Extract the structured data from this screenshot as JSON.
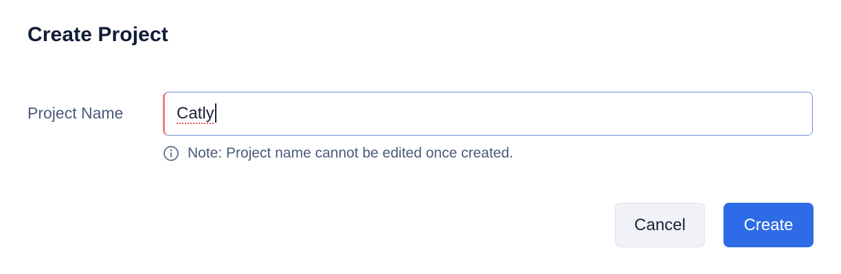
{
  "dialog": {
    "title": "Create Project"
  },
  "form": {
    "project_name": {
      "label": "Project Name",
      "value": "Catly"
    },
    "note": {
      "icon": "info-icon",
      "text": "Note: Project name cannot be edited once created."
    }
  },
  "actions": {
    "cancel_label": "Cancel",
    "create_label": "Create"
  },
  "colors": {
    "primary": "#2e6be6",
    "title_text": "#111c36",
    "muted_text": "#4a5a7a",
    "input_border_focus": "#6f8fd8",
    "input_error_edge": "#ee7f86",
    "spellcheck_underline": "#e04a55",
    "cancel_bg": "#f0f2f8"
  }
}
